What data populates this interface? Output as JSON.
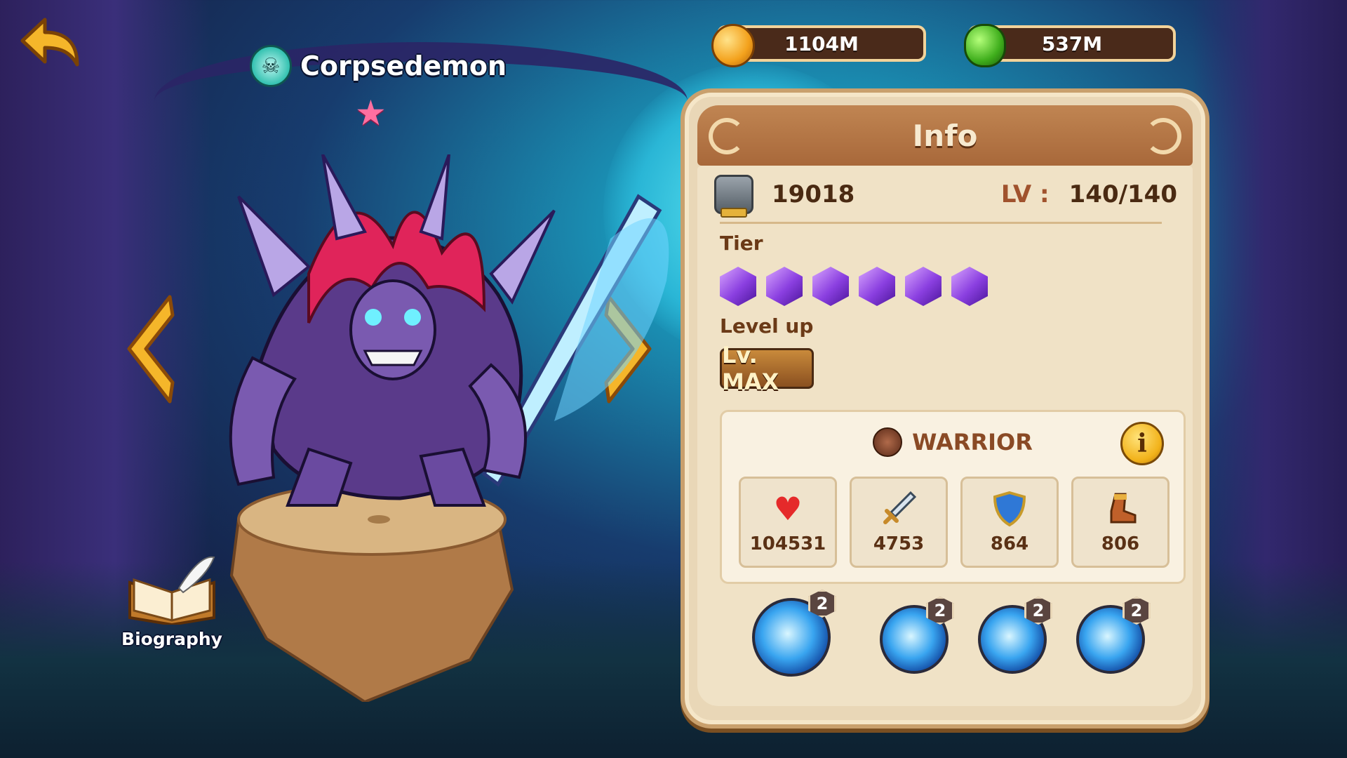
{
  "hero": {
    "name": "Corpsedemon",
    "faction_icon": "skull-icon",
    "stars": 1
  },
  "currency": {
    "gold": "1104M",
    "gems": "537M"
  },
  "biography_label": "Biography",
  "info": {
    "title": "Info",
    "power": "19018",
    "level_label": "LV :",
    "level_value": "140/140",
    "tier_label": "Tier",
    "tier_gems": 6,
    "level_up_label": "Level up",
    "level_up_button": "Lv. MAX",
    "class": "WARRIOR",
    "info_button": "i",
    "stats": {
      "hp": "104531",
      "attack": "4753",
      "armor": "864",
      "speed": "806"
    },
    "skills": [
      {
        "name": "skill-1",
        "level": "2"
      },
      {
        "name": "skill-2",
        "level": "2"
      },
      {
        "name": "skill-3",
        "level": "2"
      },
      {
        "name": "skill-4",
        "level": "2"
      }
    ]
  },
  "colors": {
    "panel": "#e9d7b7",
    "header": "#a8683a",
    "tier_gem": "#8a3fe0",
    "info_button": "#f2b21a"
  }
}
